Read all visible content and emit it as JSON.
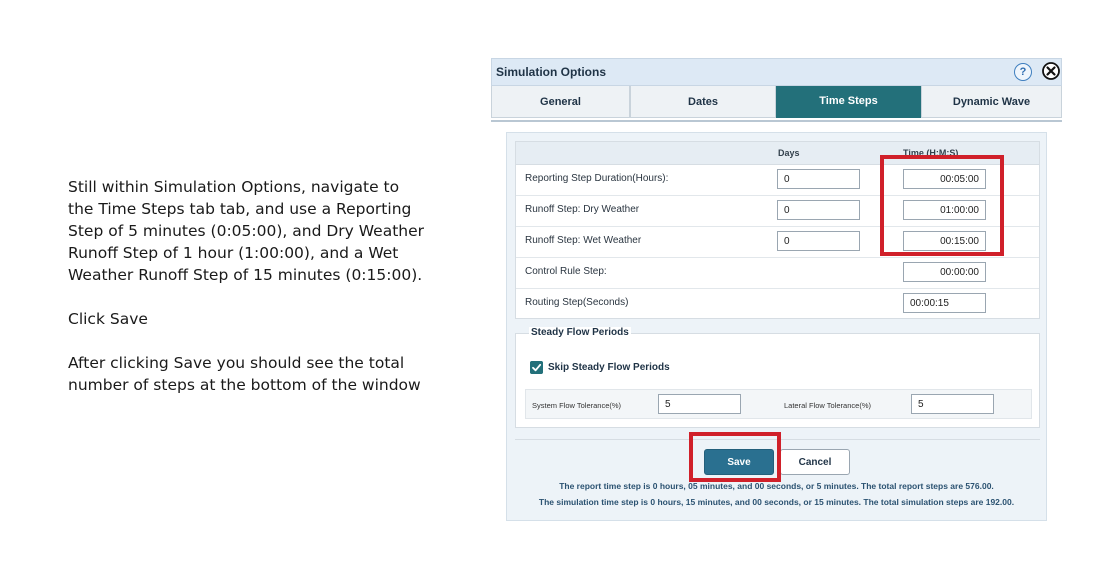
{
  "instructions": {
    "para1": "Still within Simulation Options, navigate to the Time Steps tab tab, and use a Reporting Step of 5 minutes (0:05:00), and Dry Weather Runoff Step of 1 hour (1:00:00), and a Wet Weather Runoff Step of 15 minutes (0:15:00).",
    "para2": "Click Save",
    "para3": "After clicking Save you should see the total number of steps at the bottom of the window"
  },
  "dialog": {
    "title": "Simulation Options",
    "help_glyph": "?",
    "tabs": [
      {
        "label": "General"
      },
      {
        "label": "Dates"
      },
      {
        "label": "Time Steps"
      },
      {
        "label": "Dynamic Wave"
      }
    ],
    "active_tab": "Time Steps",
    "grid": {
      "col_days": "Days",
      "col_time": "Time (H:M:S)",
      "rows": [
        {
          "label": "Reporting Step Duration(Hours):",
          "days": "0",
          "time": "00:05:00"
        },
        {
          "label": "Runoff Step: Dry Weather",
          "days": "0",
          "time": "01:00:00"
        },
        {
          "label": "Runoff Step: Wet Weather",
          "days": "0",
          "time": "00:15:00"
        },
        {
          "label": "Control Rule Step:",
          "time": "00:00:00"
        },
        {
          "label": "Routing Step(Seconds)",
          "time": "00:00:15"
        }
      ]
    },
    "steady": {
      "title": "Steady Flow Periods",
      "skip_label": "Skip Steady Flow Periods",
      "skip_checked": true,
      "system_tol_label": "System Flow Tolerance(%)",
      "system_tol_value": "5",
      "lateral_tol_label": "Lateral Flow Tolerance(%)",
      "lateral_tol_value": "5"
    },
    "buttons": {
      "save": "Save",
      "cancel": "Cancel"
    },
    "messages": {
      "report": "The report time step is 0 hours, 05 minutes, and 00 seconds, or 5 minutes. The total report steps are 576.00.",
      "simulation": "The simulation time step is 0 hours, 15 minutes, and 00 seconds, or 15 minutes. The total simulation steps are 192.00."
    }
  },
  "colors": {
    "accent": "#23707a",
    "highlight": "#d0202a",
    "title_bar": "#dde9f5"
  }
}
